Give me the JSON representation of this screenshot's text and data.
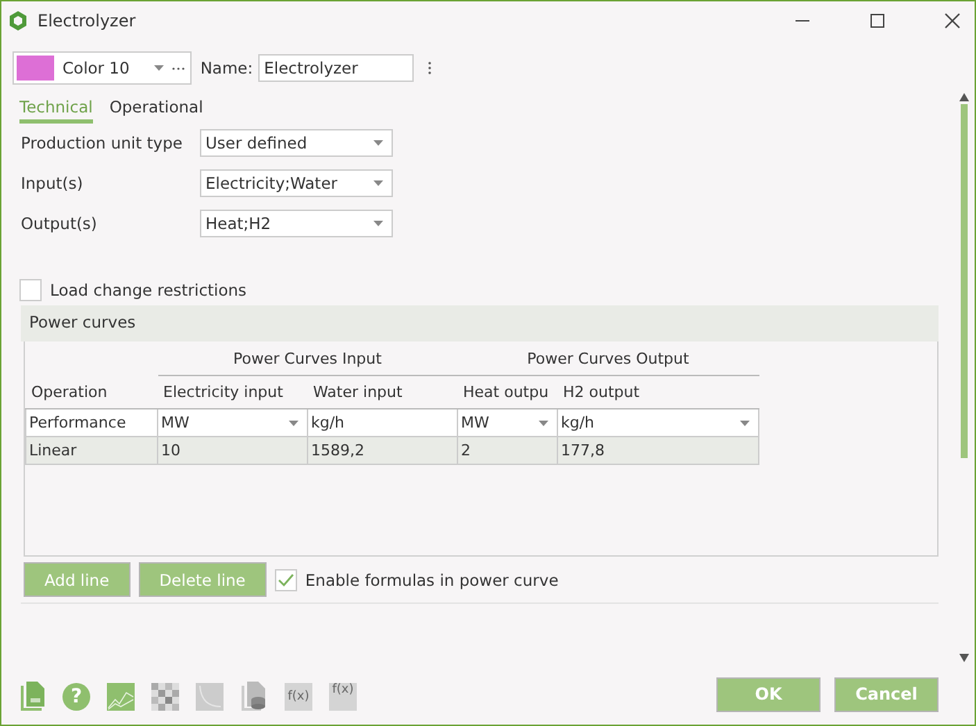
{
  "window": {
    "title": "Electrolyzer"
  },
  "color_picker": {
    "label": "Color 10",
    "color": "#dd6fd6"
  },
  "name_field": {
    "label": "Name:",
    "value": "Electrolyzer"
  },
  "tabs": [
    {
      "label": "Technical",
      "selected": true
    },
    {
      "label": "Operational",
      "selected": false
    }
  ],
  "fields": [
    {
      "label": "Production unit type",
      "value": "User defined"
    },
    {
      "label": "Input(s)",
      "value": "Electricity;Water"
    },
    {
      "label": "Output(s)",
      "value": "Heat;H2"
    }
  ],
  "load_change": {
    "label": "Load change restrictions",
    "checked": false
  },
  "power_curves": {
    "title": "Power curves",
    "groups": [
      "Power Curves Input",
      "Power Curves Output"
    ],
    "columns": [
      "Operation",
      "Electricity input",
      "Water input",
      "Heat outpu",
      "H2 output"
    ],
    "unit_row": [
      {
        "value": "Performance",
        "dropdown": false
      },
      {
        "value": "MW",
        "dropdown": true
      },
      {
        "value": "kg/h",
        "dropdown": false
      },
      {
        "value": "MW",
        "dropdown": true
      },
      {
        "value": "kg/h",
        "dropdown": true
      }
    ],
    "rows": [
      [
        "Linear",
        "10",
        "1589,2",
        "2",
        "177,8"
      ]
    ],
    "buttons": [
      "Add line",
      "Delete line"
    ],
    "formulas": {
      "label": "Enable formulas in power curve",
      "checked": true
    }
  },
  "toolbar": [
    {
      "kind": "document",
      "disabled": false
    },
    {
      "kind": "help",
      "label": "?",
      "disabled": false
    },
    {
      "kind": "chart",
      "disabled": false
    },
    {
      "kind": "grid",
      "disabled": true
    },
    {
      "kind": "curve",
      "disabled": true
    },
    {
      "kind": "database",
      "disabled": true
    },
    {
      "kind": "formula",
      "label": "f(x)",
      "disabled": true
    },
    {
      "kind": "formula-check",
      "label": "f(x)",
      "disabled": true
    }
  ],
  "buttons": [
    "OK",
    "Cancel"
  ]
}
